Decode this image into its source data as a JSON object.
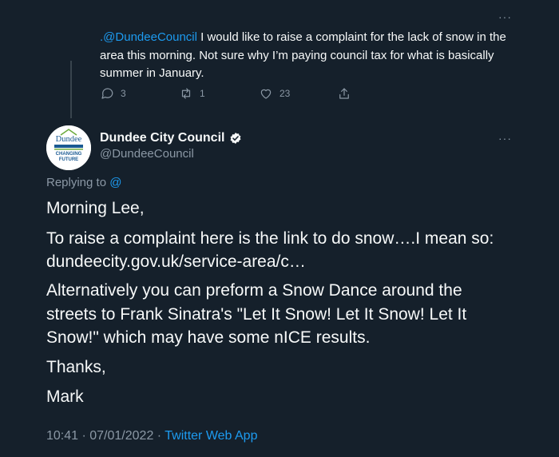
{
  "parent_tweet": {
    "mention": ".@DundeeCouncil",
    "text": " I would like to raise a complaint for the lack of snow in the area this morning. Not sure why I’m paying council tax for what is basically summer in January.",
    "replies": "3",
    "retweets": "1",
    "likes": "23",
    "more": "···"
  },
  "main_tweet": {
    "avatar_lines": [
      "Dundee",
      "CHANGING",
      "FUTURE"
    ],
    "author_name": "Dundee City Council",
    "handle": "@DundeeCouncil",
    "more": "···",
    "replying_prefix": "Replying to ",
    "replying_handle": "@",
    "greeting": "Morning Lee,",
    "line1": "To raise a complaint here is the link to do snow….I mean so:",
    "link": "dundeecity.gov.uk/service-area/c…",
    "paragraph2": "Alternatively you can preform a Snow Dance around the streets to Frank Sinatra's \"Let It Snow! Let It Snow! Let It Snow!\" which may have some nICE results.",
    "thanks": "Thanks,",
    "signature": "Mark",
    "time": "10:41 · 07/01/2022 · ",
    "source": "Twitter Web App"
  }
}
